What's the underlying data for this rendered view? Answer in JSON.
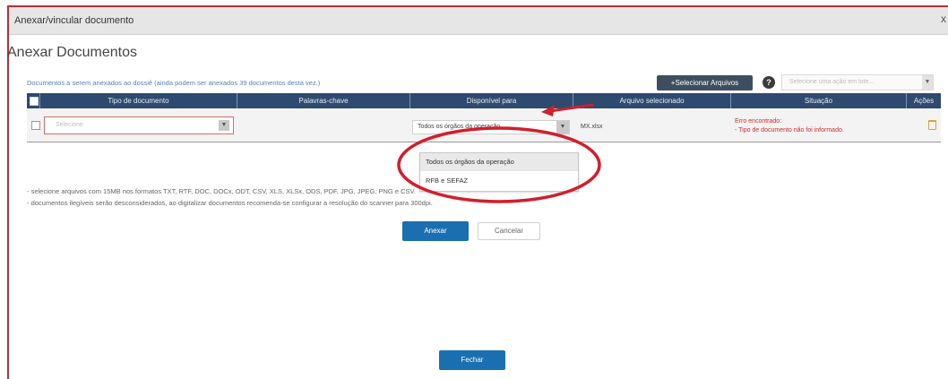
{
  "window": {
    "title": "Anexar/vincular documento",
    "close_glyph": "x"
  },
  "heading": "Anexar Documentos",
  "subheading": "Documentos a serem anexados ao dossiê (ainda podem ser anexados 39 documentos desta vez.)",
  "toolbar": {
    "select_files_label": "+Selecionar Arquivos",
    "help_glyph": "?",
    "action_placeholder": "Selecione uma ação em lote...",
    "action_arrow": "▼"
  },
  "table": {
    "headers": {
      "tipo": "Tipo de documento",
      "palavras": "Palavras-chave",
      "disponivel": "Disponível para",
      "arquivo": "Arquivo selecionado",
      "situacao": "Situação",
      "acoes": "Ações"
    },
    "row": {
      "tipo_placeholder": "Selecione",
      "tipo_arrow": "▼",
      "disponivel_value": "Todos os órgãos da operação",
      "disponivel_arrow": "▼",
      "arquivo_value": "MX.xlsx",
      "situacao_title": "Erro encontrado:",
      "situacao_detail": "- Tipo de documento não foi informado."
    }
  },
  "dropdown": {
    "options": [
      "Todos os órgãos da operação",
      "RFB e SEFAZ"
    ]
  },
  "info": {
    "line1": "- selecione arquivos com 15MB nos formatos TXT, RTF, DOC, DOCx, ODT, CSV, XLS, XLSx, ODS, PDF, JPG, JPEG, PNG e CSV.",
    "line2": "- documentos ilegíveis serão desconsiderados, ao digitalizar documentos recomenda-se configurar a resolução do scanner para 300dpi."
  },
  "buttons": {
    "anexar": "Anexar",
    "cancelar": "Cancelar",
    "fechar": "Fechar"
  },
  "colors": {
    "table_header": "#2e4a6e",
    "primary_button": "#1a6fb0",
    "annotation_red": "#d11f2c",
    "error_text": "#cf2a2a"
  },
  "icons": {
    "trash": "trash-icon",
    "help": "help-icon"
  }
}
